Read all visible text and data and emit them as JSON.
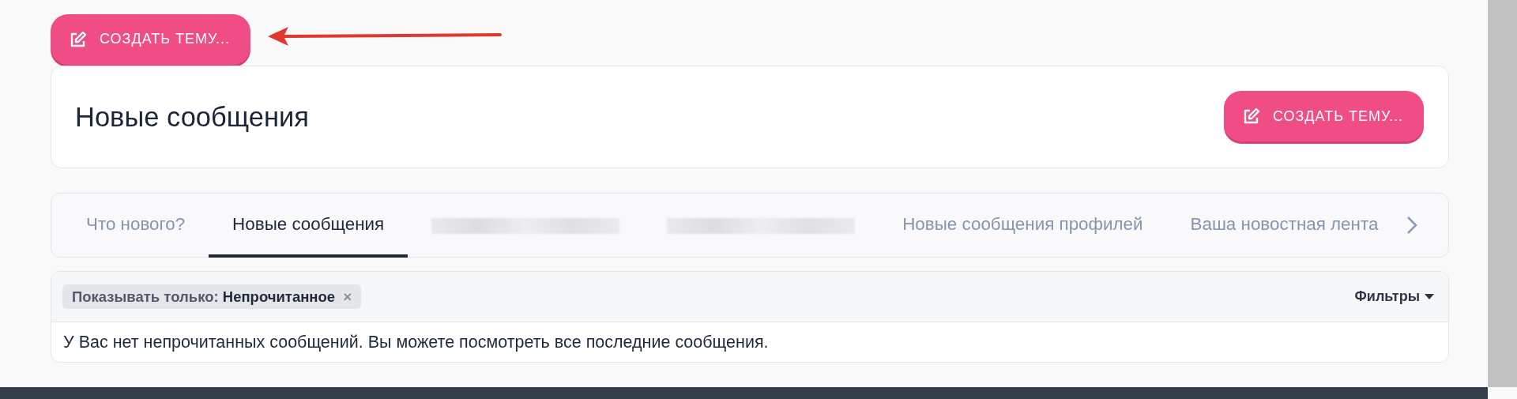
{
  "top_button": {
    "label": "СОЗДАТЬ ТЕМУ..."
  },
  "annotation": {
    "arrow": true
  },
  "header": {
    "title": "Новые сообщения",
    "button": {
      "label": "СОЗДАТЬ ТЕМУ..."
    }
  },
  "tabs": [
    {
      "kind": "text",
      "label": "Что нового?",
      "selected": false
    },
    {
      "kind": "text",
      "label": "Новые сообщения",
      "selected": true
    },
    {
      "kind": "blurred",
      "selected": false
    },
    {
      "kind": "blurred",
      "selected": false
    },
    {
      "kind": "text",
      "label": "Новые сообщения профилей",
      "selected": false
    },
    {
      "kind": "text",
      "label": "Ваша новостная лента",
      "selected": false
    }
  ],
  "filter_bar": {
    "active_filter": "Показывать только: **Непрочитанное**",
    "remove": "×",
    "filters_label": "Фильтры"
  },
  "message": "У Вас нет непрочитанных сообщений. Вы можете посмотреть все последние сообщения."
}
